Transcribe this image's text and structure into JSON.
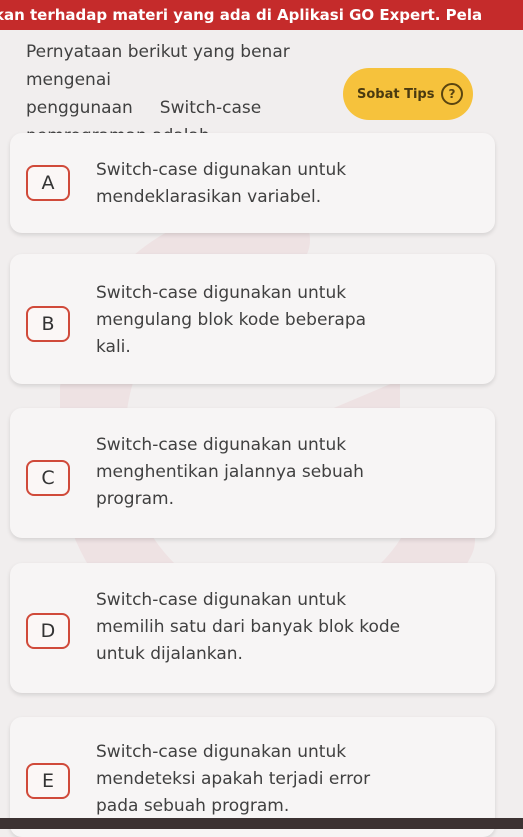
{
  "banner": {
    "text": "kan terhadap materi yang ada di Aplikasi GO Expert. Pela"
  },
  "question": {
    "lines": [
      "Pernyataan berikut yang benar mengenai",
      "penggunaan     Switch-case",
      "pemrograman adalah"
    ]
  },
  "tips_button": {
    "label": "Sobat Tips",
    "icon": "question-circle-icon",
    "icon_glyph": "?"
  },
  "options": [
    {
      "letter": "A",
      "lines": [
        "Switch-case digunakan untuk",
        "mendeklarasikan variabel."
      ]
    },
    {
      "letter": "B",
      "lines": [
        "Switch-case digunakan untuk",
        "mengulang blok kode beberapa",
        "kali."
      ]
    },
    {
      "letter": "C",
      "lines": [
        "Switch-case digunakan untuk",
        "menghentikan jalannya sebuah",
        "program."
      ]
    },
    {
      "letter": "D",
      "lines": [
        "Switch-case digunakan untuk",
        "memilih satu dari banyak blok kode",
        "untuk dijalankan."
      ]
    },
    {
      "letter": "E",
      "lines": [
        "Switch-case digunakan untuk",
        "mendeteksi apakah terjadi error",
        "pada sebuah program."
      ]
    }
  ],
  "colors": {
    "accent": "#c52b2b",
    "tips": "#f6c23c",
    "option_border": "#d04a3a"
  }
}
